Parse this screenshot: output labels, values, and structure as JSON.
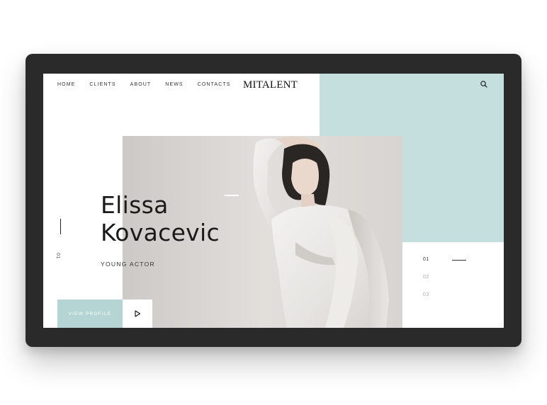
{
  "nav": {
    "items": [
      {
        "label": "HOME"
      },
      {
        "label": "CLIENTS"
      },
      {
        "label": "ABOUT"
      },
      {
        "label": "NEWS"
      },
      {
        "label": "CONTACTS"
      }
    ]
  },
  "brand": {
    "logo": "MITALENT"
  },
  "hero": {
    "first_name": "Elissa",
    "last_name": "Kovacevic",
    "role": "YOUNG ACTOR",
    "side_index": "01",
    "cta_label": "VIEW PROFILE"
  },
  "pager": {
    "items": [
      {
        "label": "01"
      },
      {
        "label": "02"
      },
      {
        "label": "03"
      }
    ],
    "active_index": 0
  },
  "icons": {
    "search": "search-icon",
    "play": "play-icon"
  },
  "colors": {
    "device_frame": "#2a2a2a",
    "mint_panel": "#c4dfde",
    "cta_background": "#b4d5d3",
    "text_dark": "#1a1a1a"
  }
}
